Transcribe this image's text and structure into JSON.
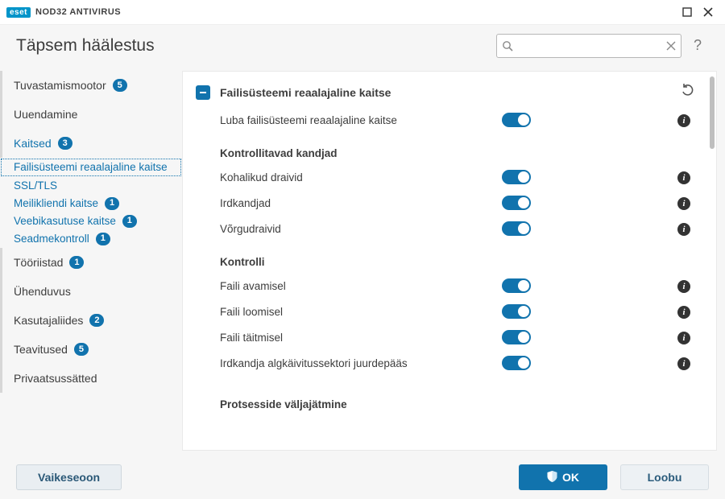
{
  "brand": {
    "badge": "eset",
    "product": "NOD32 ANTIVIRUS"
  },
  "header": {
    "title": "Täpsem häälestus"
  },
  "search": {
    "placeholder": ""
  },
  "sidebar": [
    {
      "label": "Tuvastamismootor",
      "badge": "5",
      "type": "section"
    },
    {
      "label": "Uuendamine",
      "type": "section"
    },
    {
      "label": "Kaitsed",
      "badge": "3",
      "type": "section",
      "blue": true
    },
    {
      "label": "Failisüsteemi reaalajaline kaitse",
      "type": "sub",
      "blue": true,
      "selected": true
    },
    {
      "label": "SSL/TLS",
      "type": "sub",
      "blue": true
    },
    {
      "label": "Meilikliendi kaitse",
      "badge": "1",
      "type": "sub",
      "blue": true
    },
    {
      "label": "Veebikasutuse kaitse",
      "badge": "1",
      "type": "sub",
      "blue": true
    },
    {
      "label": "Seadmekontroll",
      "badge": "1",
      "type": "sub",
      "blue": true
    },
    {
      "label": "Tööriistad",
      "badge": "1",
      "type": "section"
    },
    {
      "label": "Ühenduvus",
      "type": "section"
    },
    {
      "label": "Kasutajaliides",
      "badge": "2",
      "type": "section"
    },
    {
      "label": "Teavitused",
      "badge": "5",
      "type": "section"
    },
    {
      "label": "Privaatsussätted",
      "type": "section"
    }
  ],
  "panel": {
    "title": "Failisüsteemi reaalajaline kaitse",
    "enable_row": "Luba failisüsteemi reaalajaline kaitse",
    "group_media": "Kontrollitavad kandjad",
    "media": [
      {
        "label": "Kohalikud draivid"
      },
      {
        "label": "Irdkandjad"
      },
      {
        "label": "Võrgudraivid"
      }
    ],
    "group_scan": "Kontrolli",
    "scan": [
      {
        "label": "Faili avamisel"
      },
      {
        "label": "Faili loomisel"
      },
      {
        "label": "Faili täitmisel"
      },
      {
        "label": "Irdkandja algkäivitussektori juurdepääs"
      }
    ],
    "group_processes": "Protsesside väljajätmine"
  },
  "footer": {
    "default": "Vaikeseoon",
    "ok": "OK",
    "cancel": "Loobu"
  }
}
